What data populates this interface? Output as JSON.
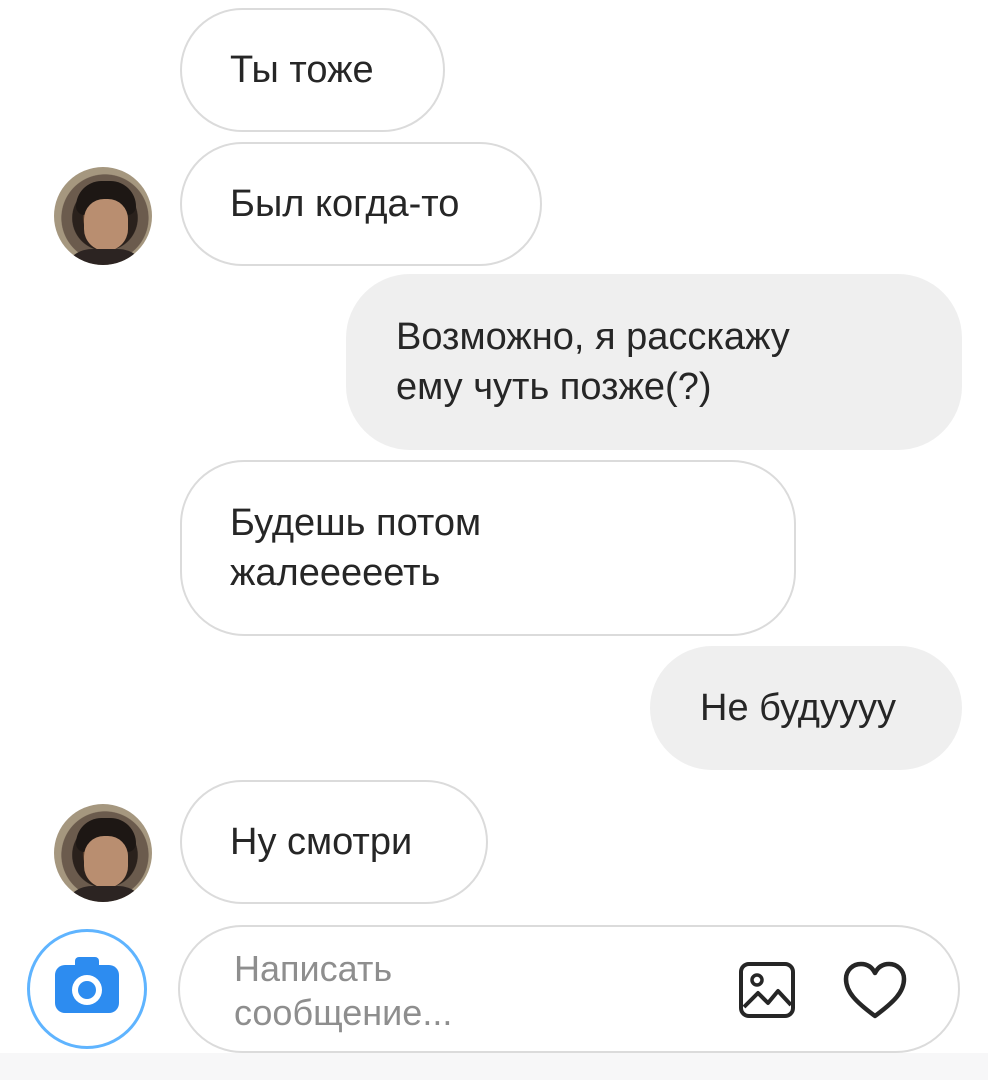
{
  "messages": [
    {
      "text": "Ты тоже",
      "direction": "incoming"
    },
    {
      "text": "Был когда-то",
      "direction": "incoming"
    },
    {
      "text": "Возможно, я расскажу\nему чуть позже(?)",
      "direction": "outgoing"
    },
    {
      "text": "Будешь потом\nжалеееееть",
      "direction": "incoming"
    },
    {
      "text": "Не будуууу",
      "direction": "outgoing"
    },
    {
      "text": "Ну смотри",
      "direction": "incoming"
    }
  ],
  "composer": {
    "placeholder": "Написать\nсообщение..."
  },
  "icons": {
    "camera": "camera-icon",
    "gallery": "gallery-icon",
    "like": "heart-icon"
  },
  "colors": {
    "incoming_border": "#dbdbdb",
    "outgoing_bg": "#efefef",
    "camera_accent": "#2d8cf0"
  }
}
